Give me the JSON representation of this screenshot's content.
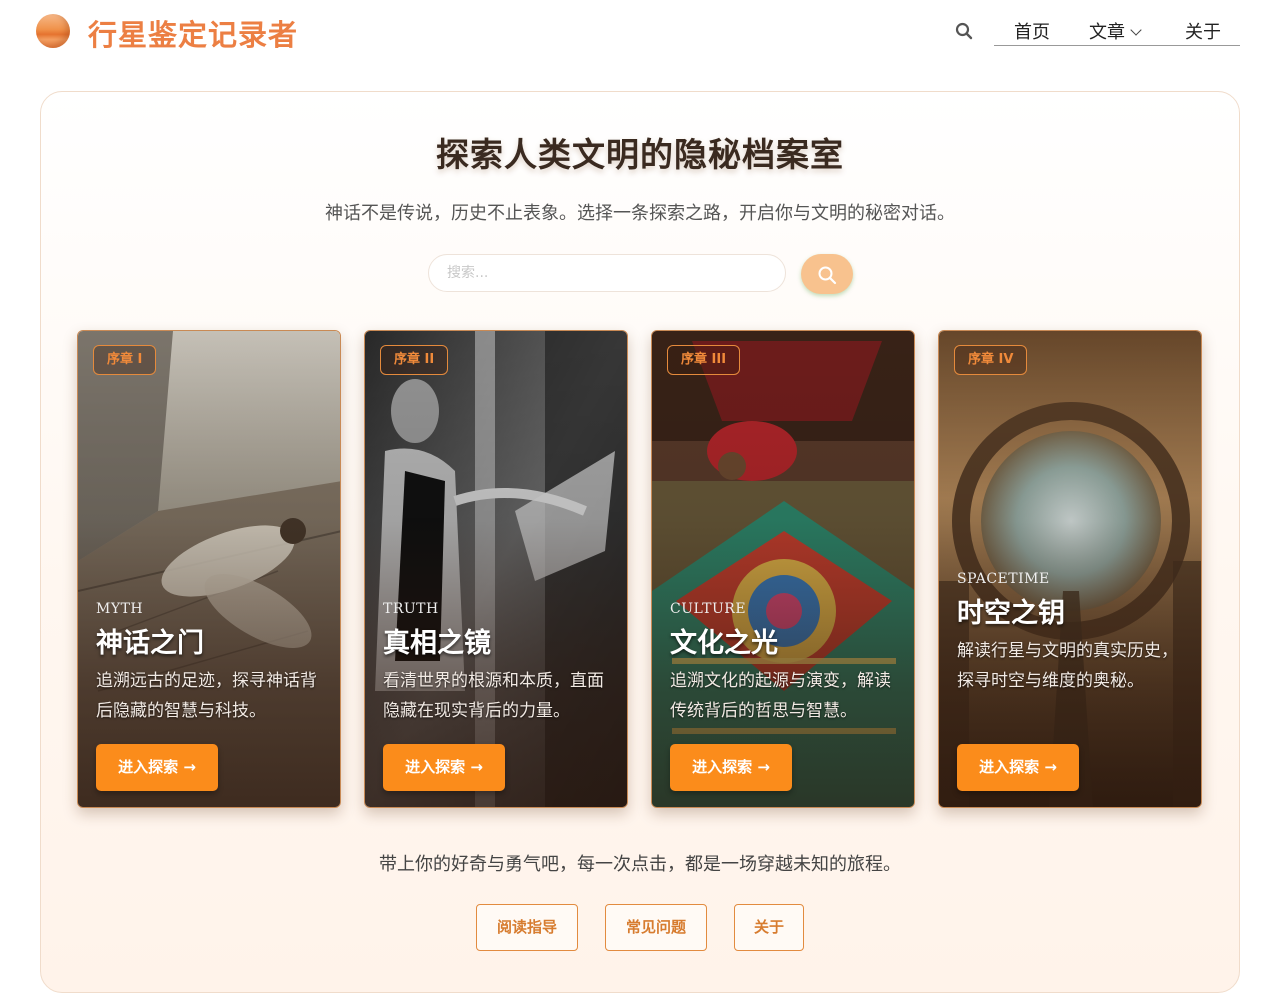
{
  "header": {
    "site_title": "行星鉴定记录者",
    "logo_icon": "planet-orb-icon",
    "nav": {
      "home": "首页",
      "articles": "文章",
      "about": "关于"
    }
  },
  "hero": {
    "title": "探索人类文明的隐秘档案室",
    "subtitle": "神话不是传说，历史不止表象。选择一条探索之路，开启你与文明的秘密对话。",
    "search_placeholder": "搜索..."
  },
  "cards": [
    {
      "tag": "序章 I",
      "eyebrow": "MYTH",
      "title": "神话之门",
      "desc": "追溯远古的足迹，探寻神话背后隐藏的智慧与科技。",
      "button": "进入探索 →"
    },
    {
      "tag": "序章 II",
      "eyebrow": "TRUTH",
      "title": "真相之镜",
      "desc": "看清世界的根源和本质，直面隐藏在现实背后的力量。",
      "button": "进入探索 →"
    },
    {
      "tag": "序章 III",
      "eyebrow": "CULTURE",
      "title": "文化之光",
      "desc": "追溯文化的起源与演变，解读传统背后的哲思与智慧。",
      "button": "进入探索 →"
    },
    {
      "tag": "序章 IV",
      "eyebrow": "SPACETIME",
      "title": "时空之钥",
      "desc": "解读行星与文明的真实历史，探寻时空与维度的奥秘。",
      "button": "进入探索 →"
    }
  ],
  "footer": {
    "text": "带上你的好奇与勇气吧，每一次点击，都是一场穿越未知的旅程。",
    "links": [
      "阅读指导",
      "常见问题",
      "关于"
    ]
  },
  "colors": {
    "accent": "#fb8c1b",
    "brand": "#ec7f43",
    "search_button": "#f8c28e"
  }
}
